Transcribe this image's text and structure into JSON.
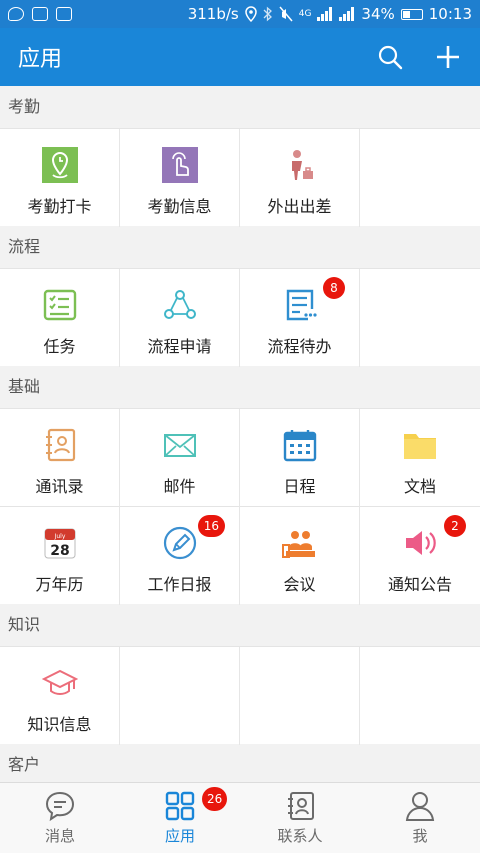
{
  "status_bar": {
    "net_speed": "311b/s",
    "network": "4G",
    "battery": "34%",
    "time": "10:13"
  },
  "header": {
    "title": "应用",
    "search_icon": "search-icon",
    "add_icon": "plus-icon"
  },
  "sections": {
    "attendance": {
      "title": "考勤",
      "items": [
        {
          "label": "考勤打卡",
          "icon": "location-clock-icon"
        },
        {
          "label": "考勤信息",
          "icon": "hand-touch-icon"
        },
        {
          "label": "外出出差",
          "icon": "business-trip-icon"
        }
      ]
    },
    "process": {
      "title": "流程",
      "items": [
        {
          "label": "任务",
          "icon": "checklist-icon"
        },
        {
          "label": "流程申请",
          "icon": "workflow-icon"
        },
        {
          "label": "流程待办",
          "icon": "pending-list-icon",
          "badge": "8"
        }
      ]
    },
    "basic": {
      "title": "基础",
      "items": [
        {
          "label": "通讯录",
          "icon": "contacts-icon"
        },
        {
          "label": "邮件",
          "icon": "mail-icon"
        },
        {
          "label": "日程",
          "icon": "calendar-icon"
        },
        {
          "label": "文档",
          "icon": "folder-icon"
        },
        {
          "label": "万年历",
          "icon": "date-calendar-icon",
          "calendar_month": "July",
          "calendar_day": "28"
        },
        {
          "label": "工作日报",
          "icon": "pencil-icon",
          "badge": "16"
        },
        {
          "label": "会议",
          "icon": "meeting-icon"
        },
        {
          "label": "通知公告",
          "icon": "speaker-icon",
          "badge": "2"
        }
      ]
    },
    "knowledge": {
      "title": "知识",
      "items": [
        {
          "label": "知识信息",
          "icon": "graduation-cap-icon"
        }
      ]
    },
    "customer": {
      "title": "客户"
    }
  },
  "bottom_nav": {
    "items": [
      {
        "label": "消息",
        "icon": "message-icon"
      },
      {
        "label": "应用",
        "icon": "apps-grid-icon",
        "badge": "26",
        "active": true
      },
      {
        "label": "联系人",
        "icon": "contact-card-icon"
      },
      {
        "label": "我",
        "icon": "person-icon"
      }
    ]
  },
  "colors": {
    "primary": "#1a86d8",
    "badge": "#e8160c"
  }
}
